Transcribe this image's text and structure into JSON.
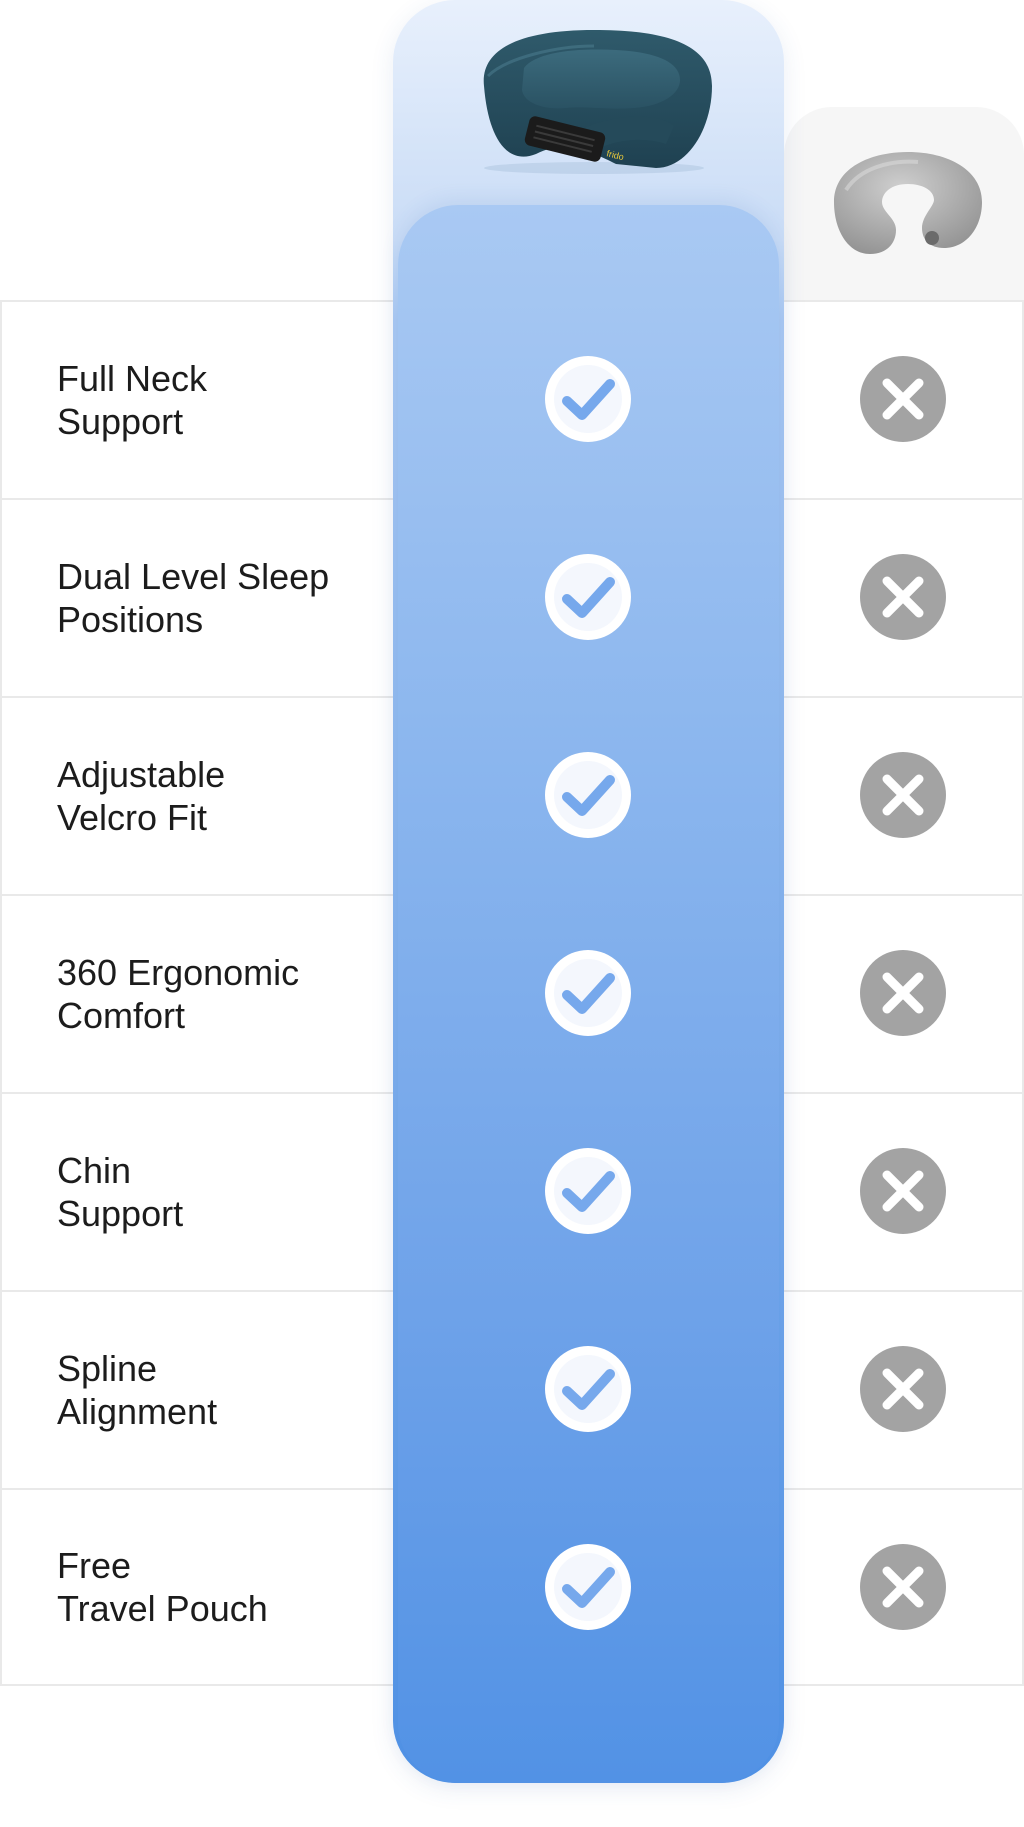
{
  "features": [
    {
      "label": "Full Neck\nSupport",
      "featured_has": true,
      "competitor_has": false
    },
    {
      "label": "Dual Level Sleep\nPositions",
      "featured_has": true,
      "competitor_has": false
    },
    {
      "label": "Adjustable\nVelcro Fit",
      "featured_has": true,
      "competitor_has": false
    },
    {
      "label": "360 Ergonomic\nComfort",
      "featured_has": true,
      "competitor_has": false
    },
    {
      "label": "Chin\nSupport",
      "featured_has": true,
      "competitor_has": false
    },
    {
      "label": "Spline\nAlignment",
      "featured_has": true,
      "competitor_has": false
    },
    {
      "label": "Free\nTravel Pouch",
      "featured_has": true,
      "competitor_has": false
    }
  ],
  "featured_product": {
    "image": "frido-travel-pillow-image",
    "brand_tag": "frido"
  },
  "competitor_product": {
    "image": "generic-u-pillow-image"
  },
  "icons": {
    "yes": "check-circle-icon",
    "no": "x-circle-icon"
  },
  "colors": {
    "featured_column_top": "#e8f0fc",
    "featured_column_bottom": "#5292e5",
    "check_mark": "#76a8ec",
    "cross_circle": "#a3a3a3",
    "competitor_column": "#f6f6f6",
    "text": "#1c1c1c",
    "row_border": "#e9e9e9"
  }
}
